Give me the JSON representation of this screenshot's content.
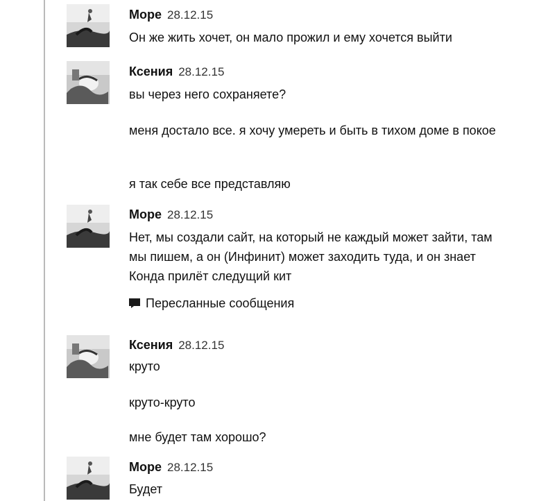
{
  "messages": [
    {
      "author": "Море",
      "date": "28.12.15",
      "avatar_icon": "sea-avatar-icon",
      "lines": [
        "Он же жить хочет, он мало прожил и ему хочется выйти"
      ]
    },
    {
      "author": "Ксения",
      "date": "28.12.15",
      "avatar_icon": "ksenia-avatar-icon",
      "lines": [
        "вы через него сохраняете?",
        "меня достало все. я хочу умереть и быть в тихом доме в покое",
        "я так себе все представляю"
      ]
    },
    {
      "author": "Море",
      "date": "28.12.15",
      "avatar_icon": "sea-avatar-icon",
      "lines": [
        "Нет, мы создали сайт, на который не каждый может зайти, там мы пишем, а он (Инфинит) может заходить туда, и он знает Конда прилёт следущий кит"
      ],
      "forwarded_label": "Пересланные сообщения",
      "forwarded_icon": "forwarded-messages-icon"
    },
    {
      "author": "Ксения",
      "date": "28.12.15",
      "avatar_icon": "ksenia-avatar-icon",
      "lines": [
        "круто",
        "круто-круто",
        "мне будет там хорошо?"
      ]
    },
    {
      "author": "Море",
      "date": "28.12.15",
      "avatar_icon": "sea-avatar-icon",
      "lines": [
        "Будет"
      ]
    }
  ]
}
